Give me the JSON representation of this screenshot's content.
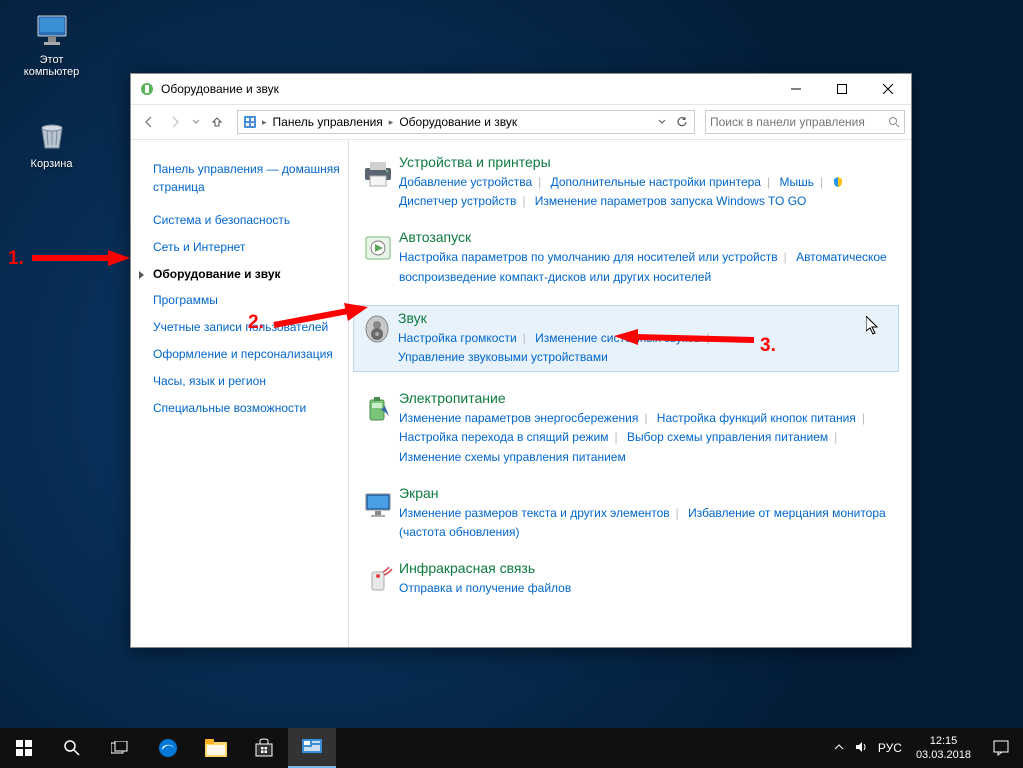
{
  "desktop": {
    "this_pc": "Этот компьютер",
    "recycle": "Корзина"
  },
  "window": {
    "title": "Оборудование и звук",
    "breadcrumb": {
      "root": "Панель управления",
      "current": "Оборудование и звук"
    },
    "search_placeholder": "Поиск в панели управления"
  },
  "sidebar": {
    "home": "Панель управления — домашняя страница",
    "items": [
      "Система и безопасность",
      "Сеть и Интернет",
      "Оборудование и звук",
      "Программы",
      "Учетные записи пользователей",
      "Оформление и персонализация",
      "Часы, язык и регион",
      "Специальные возможности"
    ]
  },
  "categories": [
    {
      "title": "Устройства и принтеры",
      "links": [
        "Добавление устройства",
        "Дополнительные настройки принтера",
        "Мышь",
        "Диспетчер устройств",
        "Изменение параметров запуска Windows TO GO"
      ],
      "shield_links": [
        3
      ]
    },
    {
      "title": "Автозапуск",
      "links": [
        "Настройка параметров по умолчанию для носителей или устройств",
        "Автоматическое воспроизведение компакт-дисков или других носителей"
      ]
    },
    {
      "title": "Звук",
      "links": [
        "Настройка громкости",
        "Изменение системных звуков",
        "Управление звуковыми устройствами"
      ],
      "highlight": true
    },
    {
      "title": "Электропитание",
      "links": [
        "Изменение параметров энергосбережения",
        "Настройка функций кнопок питания",
        "Настройка перехода в спящий режим",
        "Выбор схемы управления питанием",
        "Изменение схемы управления питанием"
      ]
    },
    {
      "title": "Экран",
      "links": [
        "Изменение размеров текста и других элементов",
        "Избавление от мерцания монитора (частота обновления)"
      ]
    },
    {
      "title": "Инфракрасная связь",
      "links": [
        "Отправка и получение файлов"
      ]
    }
  ],
  "annotations": {
    "one": "1.",
    "two": "2.",
    "three": "3."
  },
  "taskbar": {
    "lang": "РУС",
    "time": "12:15",
    "date": "03.03.2018"
  }
}
